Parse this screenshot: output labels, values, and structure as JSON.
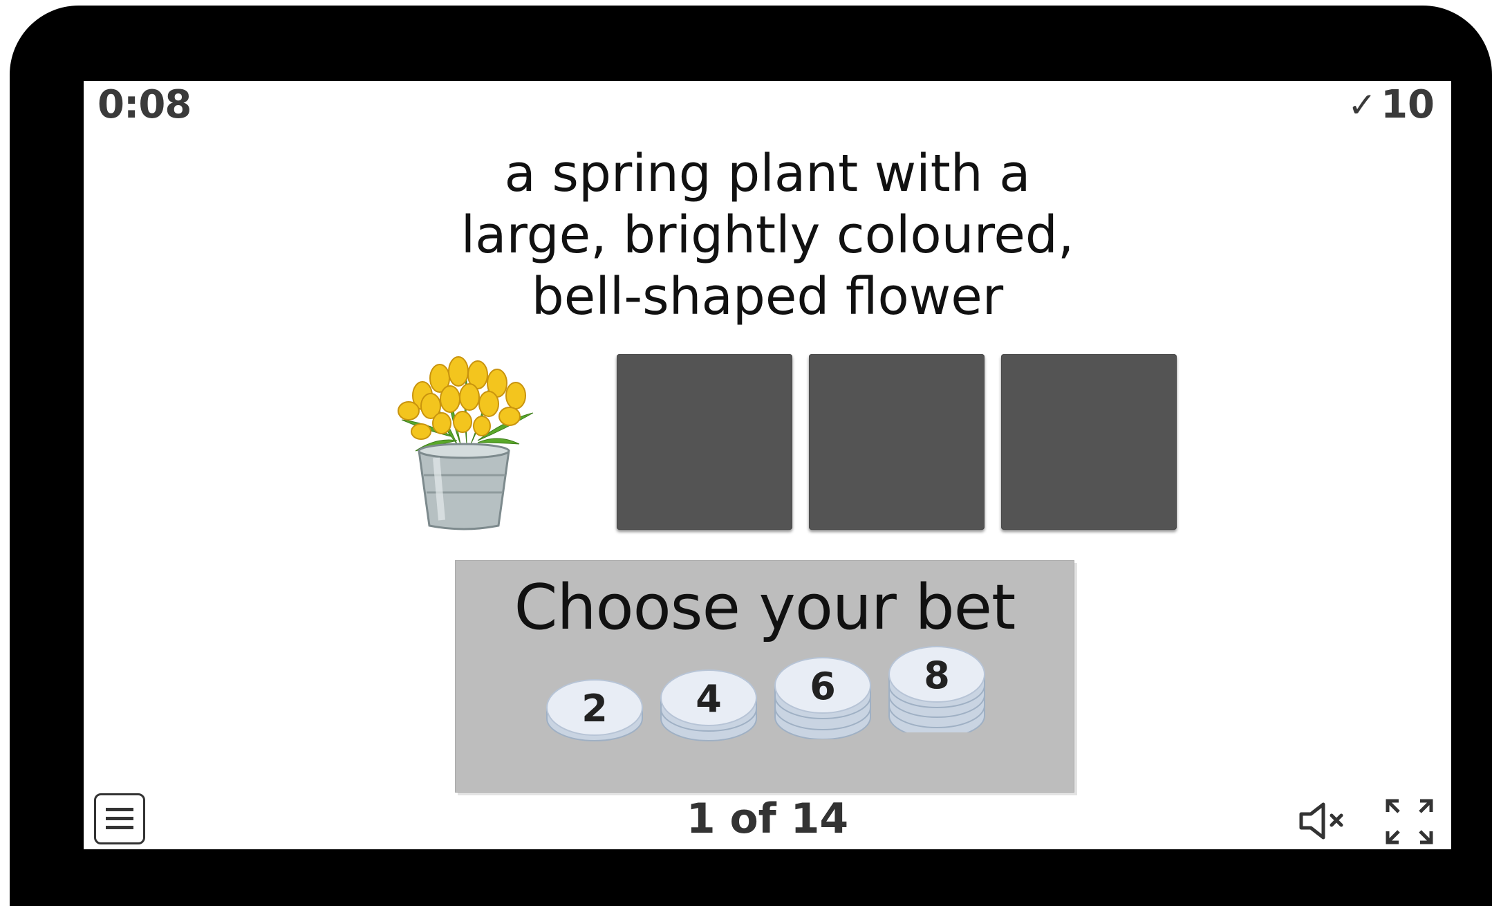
{
  "game": {
    "timer": "0:08",
    "score_icon": "checkmark-icon",
    "score_value": "10",
    "clue_lines": [
      "a spring plant with a",
      "large, brightly coloured,",
      "bell-shaped flower"
    ],
    "picture_icon": "tulips-in-bucket-image",
    "answer_tiles": 3,
    "bet": {
      "title": "Choose your bet",
      "options": [
        "2",
        "4",
        "6",
        "8"
      ]
    },
    "progress": "1 of 14",
    "controls": [
      "menu-icon",
      "mute-icon",
      "fullscreen-icon"
    ]
  },
  "colors": {
    "device": "#000000",
    "screen": "#ffffff",
    "tile": "#545454",
    "bet_panel": "#bdbdbd",
    "chip": "#e6ebf3"
  }
}
